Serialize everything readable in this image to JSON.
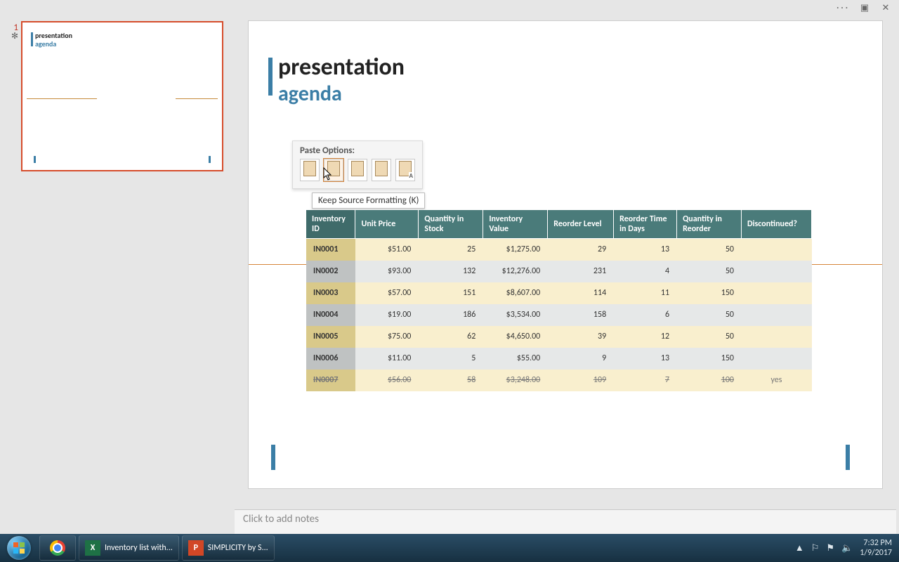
{
  "window": {
    "dots": "···",
    "maximize": "▣",
    "close": "✕"
  },
  "slide": {
    "title": "presentation",
    "subtitle": "agenda",
    "thumb_index": "1",
    "thumb_star": "✻"
  },
  "paste_options": {
    "title": "Paste Options:",
    "tooltip": "Keep Source Formatting (K)",
    "items": [
      "📋",
      "📋",
      "📋",
      "📋",
      "A"
    ]
  },
  "table": {
    "headers": [
      "Inventory ID",
      "Unit Price",
      "Quantity in Stock",
      "Inventory Value",
      "Reorder Level",
      "Reorder Time in Days",
      "Quantity in Reorder",
      "Discontinued?"
    ],
    "rows": [
      {
        "id": "IN0001",
        "price": "$51.00",
        "qty": "25",
        "value": "$1,275.00",
        "reorder": "29",
        "days": "13",
        "qreorder": "50",
        "disc": "",
        "strike": false
      },
      {
        "id": "IN0002",
        "price": "$93.00",
        "qty": "132",
        "value": "$12,276.00",
        "reorder": "231",
        "days": "4",
        "qreorder": "50",
        "disc": "",
        "strike": false
      },
      {
        "id": "IN0003",
        "price": "$57.00",
        "qty": "151",
        "value": "$8,607.00",
        "reorder": "114",
        "days": "11",
        "qreorder": "150",
        "disc": "",
        "strike": false
      },
      {
        "id": "IN0004",
        "price": "$19.00",
        "qty": "186",
        "value": "$3,534.00",
        "reorder": "158",
        "days": "6",
        "qreorder": "50",
        "disc": "",
        "strike": false
      },
      {
        "id": "IN0005",
        "price": "$75.00",
        "qty": "62",
        "value": "$4,650.00",
        "reorder": "39",
        "days": "12",
        "qreorder": "50",
        "disc": "",
        "strike": false
      },
      {
        "id": "IN0006",
        "price": "$11.00",
        "qty": "5",
        "value": "$55.00",
        "reorder": "9",
        "days": "13",
        "qreorder": "150",
        "disc": "",
        "strike": false
      },
      {
        "id": "IN0007",
        "price": "$56.00",
        "qty": "58",
        "value": "$3,248.00",
        "reorder": "109",
        "days": "7",
        "qreorder": "100",
        "disc": "yes",
        "strike": true
      }
    ]
  },
  "notes": {
    "placeholder": "Click to add notes"
  },
  "taskbar": {
    "excel_label": "Inventory list with...",
    "ppt_label": "SIMPLICITY by S...",
    "tray_up": "▲",
    "tray_flag": "⚐",
    "tray_action": "⚑",
    "tray_sound": "🔈",
    "time": "7:32 PM",
    "date": "1/9/2017"
  }
}
